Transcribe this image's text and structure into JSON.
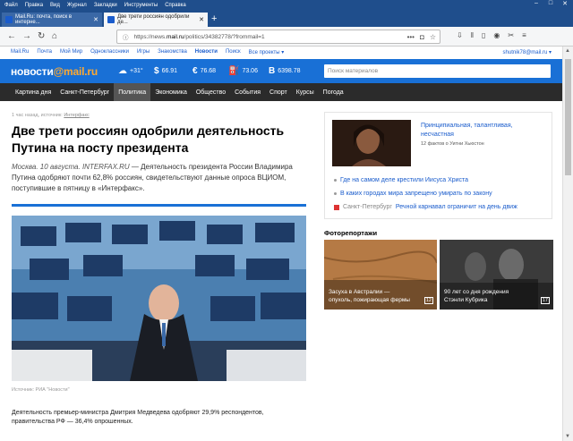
{
  "menu": [
    "Файл",
    "Правка",
    "Вид",
    "Журнал",
    "Закладки",
    "Инструменты",
    "Справка"
  ],
  "tabs": [
    {
      "label": "Mail.Ru: почта, поиск в интерне..."
    },
    {
      "label": "Две трети россиян одобрили де..."
    }
  ],
  "url": {
    "prefix": "https://news.",
    "domain": "mail.ru",
    "path": "/politics/34382778/?frommail=1"
  },
  "portal": {
    "links": [
      "Mail.Ru",
      "Почта",
      "Мой Мир",
      "Одноклассники",
      "Игры",
      "Знакомства",
      "Новости",
      "Поиск",
      "Все проекты ▾"
    ],
    "user": "shutnik78@mail.ru ▾"
  },
  "header": {
    "logo_a": "новости",
    "logo_b": "@mail.ru",
    "weather": "+31°",
    "usd_icon": "$",
    "usd": "66.91",
    "eur_icon": "€",
    "eur": "76.68",
    "oil": "73.06",
    "btc_icon": "B",
    "btc": "6398.78",
    "search_placeholder": "Поиск материалов"
  },
  "nav": [
    "Картина дня",
    "Санкт-Петербург",
    "Политика",
    "Экономика",
    "Общество",
    "События",
    "Спорт",
    "Курсы",
    "Погода"
  ],
  "article": {
    "meta_time": "1 час назад, источник: ",
    "meta_src": "Интерфакс",
    "title": "Две трети россиян одобрили деятельность Путина на посту президента",
    "lead_italic": "Москва. 10 августа. INTERFAX.RU",
    "lead": " — Деятельность президента России Владимира Путина одобряют почти 62,8% россиян, свидетельствуют данные опроса ВЦИОМ, поступившие в пятницу в «Интерфакс».",
    "caption": "Источник: РИА \"Новости\"",
    "body": "Деятельность премьер-министра Дмитрия Медведева одобряют 29,9% респондентов, правительства РФ — 36,4% опрошенных."
  },
  "sidebar": {
    "feature": "Принципиальная, талантливая, несчастная",
    "feature_count": "12 фактов о Уитни Хьюстон",
    "items": [
      {
        "text": "Где на самом деле крестили Иисуса Христа"
      },
      {
        "text": "В каких городах мира запрещено умирать по закону"
      },
      {
        "tag": "Санкт-Петербург",
        "text": "Речной карнавал ограничит на день движ"
      }
    ]
  },
  "photos": {
    "title": "Фоторепортажи",
    "items": [
      {
        "caption": "Засуха в Австралии — опухоль, пожирающая фермы",
        "count": "12"
      },
      {
        "caption": "90 лет со дня рождения Стэнли Кубрика",
        "count": "17"
      }
    ]
  },
  "colors": {
    "brand": "#1970d6",
    "accent": "#ffa930",
    "nav": "#2b2b2b",
    "link": "#1a5ccc"
  }
}
